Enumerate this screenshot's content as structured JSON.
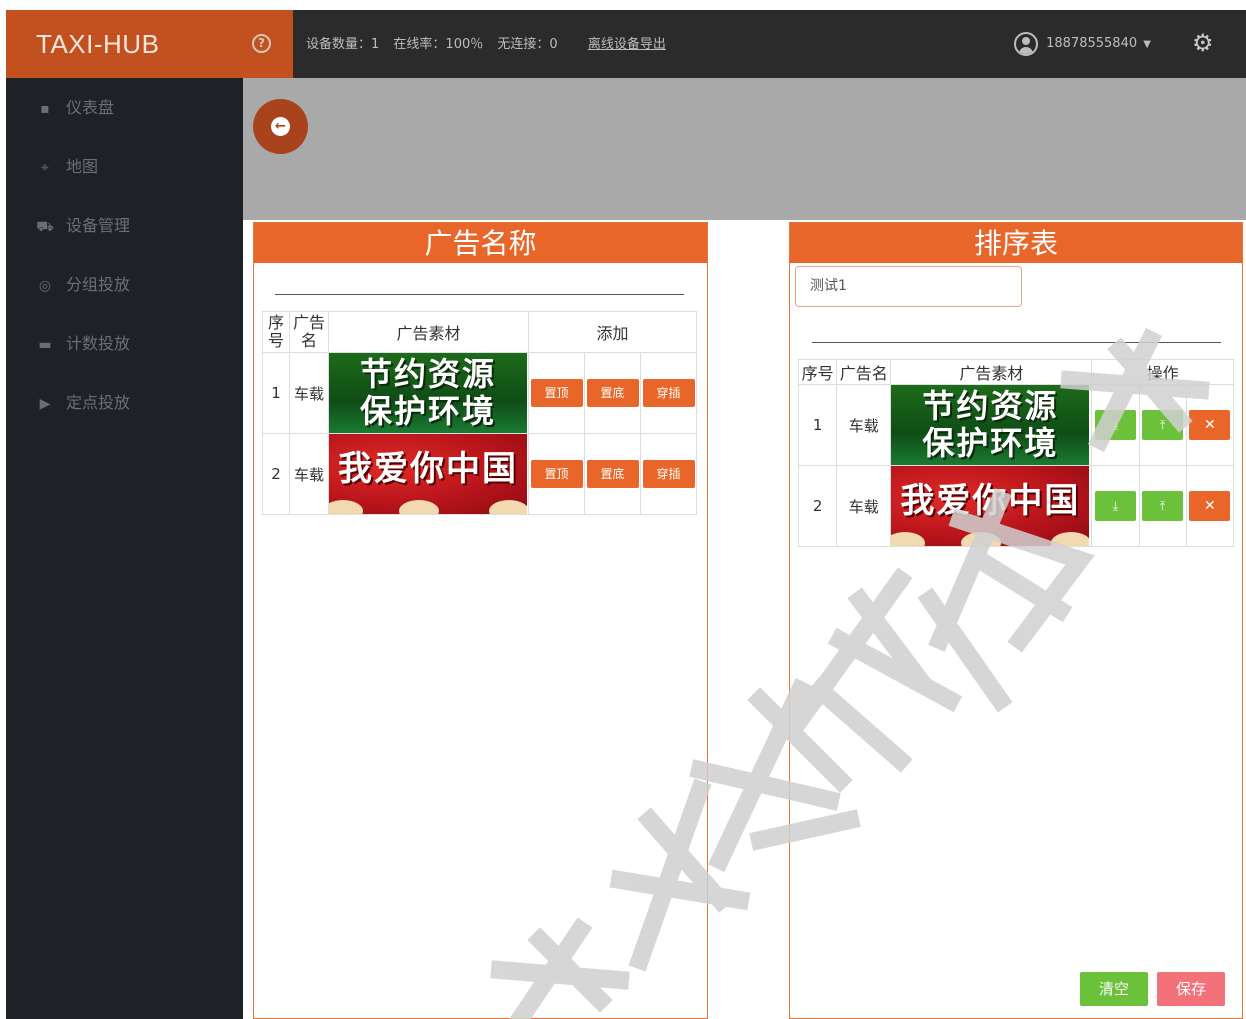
{
  "header": {
    "brand": "TAXI-HUB",
    "device_count": "设备数量：1",
    "online_rate": "在线率：100％",
    "no_connection": "无连接：0",
    "export_offline": "离线设备导出",
    "user_phone": "18878555840",
    "icons": {
      "help": "help-circle-icon",
      "user": "user-circle-icon",
      "settings": "gear-icon"
    }
  },
  "sidebar": {
    "items": [
      {
        "label": "仪表盘",
        "icon": "dashboard-icon"
      },
      {
        "label": "地图",
        "icon": "map-pin-icon"
      },
      {
        "label": "设备管理",
        "icon": "car-icon"
      },
      {
        "label": "分组投放",
        "icon": "group-icon"
      },
      {
        "label": "计数投放",
        "icon": "counter-icon"
      },
      {
        "label": "定点投放",
        "icon": "play-icon"
      }
    ]
  },
  "left_panel": {
    "title": "广告名称",
    "columns": [
      "序号",
      "广告名",
      "广告素材",
      "添加"
    ],
    "rows": [
      {
        "index": "1",
        "name": "车载",
        "ad_text_line1": "节约资源",
        "ad_text_line2": "保护环境",
        "ad_style": "green",
        "actions": [
          "置顶",
          "置底",
          "穿插"
        ]
      },
      {
        "index": "2",
        "name": "车载",
        "ad_text_line1": "我爱你中国",
        "ad_text_line2": "",
        "ad_style": "red",
        "actions": [
          "置顶",
          "置底",
          "穿插"
        ]
      }
    ]
  },
  "right_panel": {
    "title": "排序表",
    "name_input_value": "测试1",
    "columns": [
      "序号",
      "广告名",
      "广告素材",
      "操作"
    ],
    "rows": [
      {
        "index": "1",
        "name": "车载",
        "ad_text_line1": "节约资源",
        "ad_text_line2": "保护环境",
        "ad_style": "green"
      },
      {
        "index": "2",
        "name": "车载",
        "ad_text_line1": "我爱你中国",
        "ad_text_line2": "",
        "ad_style": "red"
      }
    ],
    "row_action_icons": {
      "down": "download-icon",
      "up": "upload-icon",
      "remove": "close-icon"
    },
    "clear_label": "清空",
    "save_label": "保存"
  },
  "colors": {
    "accent": "#e8662a",
    "brand_bg": "#c2511f",
    "topbar": "#2b2b2b",
    "sidebar": "#1e2126",
    "green": "#6bc23a",
    "pink": "#f3727a"
  }
}
